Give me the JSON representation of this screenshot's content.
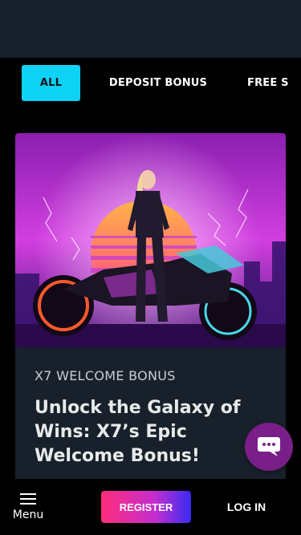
{
  "tabs": [
    {
      "label": "ALL",
      "active": true
    },
    {
      "label": "DEPOSIT BONUS",
      "active": false
    },
    {
      "label": "FREE S",
      "active": false
    }
  ],
  "promo": {
    "category": "X7 WELCOME BONUS",
    "title": "Unlock the Galaxy of Wins: X7’s Epic Welcome Bonus!",
    "image_icon": "cyberpunk-rider-image"
  },
  "chat": {
    "icon": "chat-icon"
  },
  "bottom_nav": {
    "menu_label": "Menu",
    "register_label": "REGISTER",
    "login_label": "LOG IN"
  },
  "colors": {
    "accent": "#0fd3f5",
    "surface": "#18212b",
    "chat": "#7a1f8a",
    "register_start": "#ff2d7a",
    "register_end": "#3a2af2"
  }
}
